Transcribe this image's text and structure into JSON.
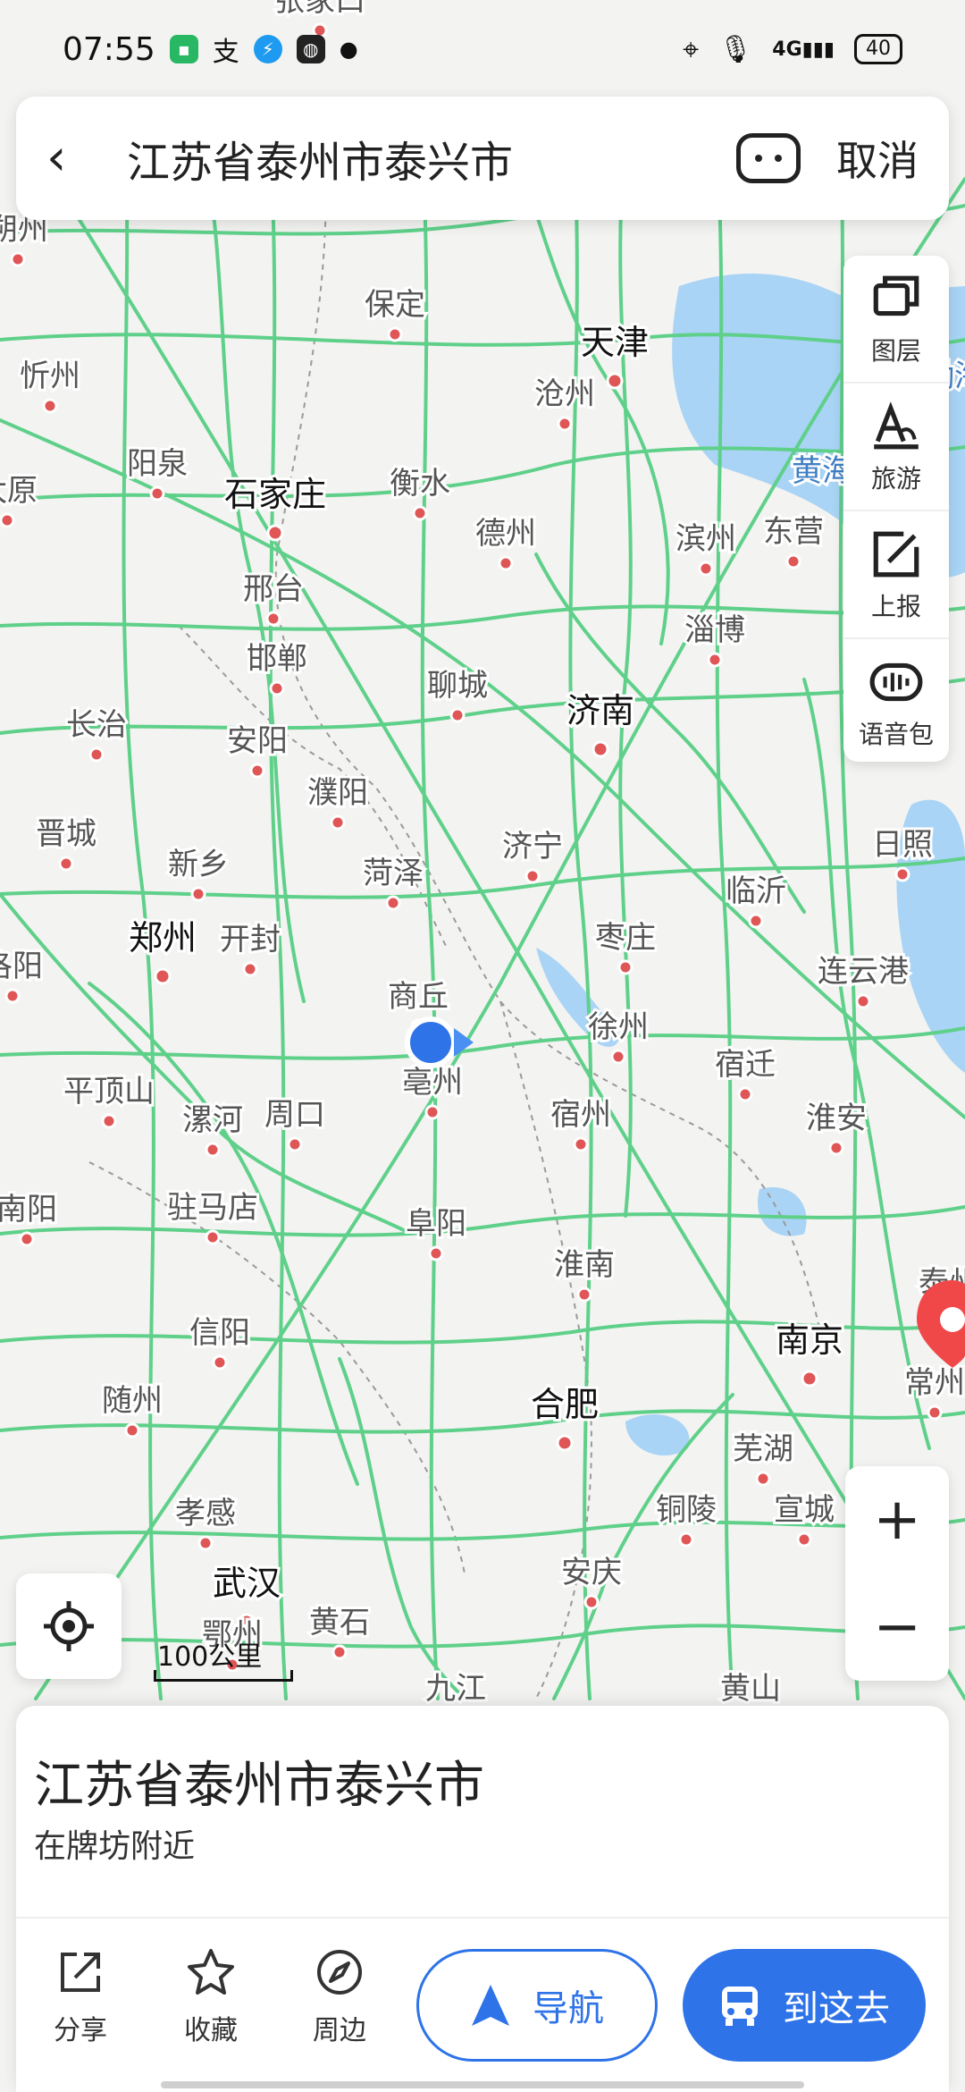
{
  "status_bar": {
    "time": "07:55",
    "network": "4G",
    "battery": "40"
  },
  "search": {
    "query": "江苏省泰州市泰兴市",
    "cancel_label": "取消"
  },
  "tools": [
    {
      "label": "图层",
      "icon": "layers-icon"
    },
    {
      "label": "旅游",
      "icon": "travel-icon"
    },
    {
      "label": "上报",
      "icon": "report-icon"
    },
    {
      "label": "语音包",
      "icon": "voice-pack-icon"
    }
  ],
  "map": {
    "scale_label": "100公里",
    "cities": [
      {
        "name": "张家口",
        "major": false
      },
      {
        "name": "朔州",
        "major": false
      },
      {
        "name": "保定",
        "major": false
      },
      {
        "name": "天津",
        "major": true
      },
      {
        "name": "忻州",
        "major": false
      },
      {
        "name": "沧州",
        "major": false
      },
      {
        "name": "阳泉",
        "major": false
      },
      {
        "name": "石家庄",
        "major": true
      },
      {
        "name": "衡水",
        "major": false
      },
      {
        "name": "太原",
        "major": false
      },
      {
        "name": "德州",
        "major": false
      },
      {
        "name": "滨州",
        "major": false
      },
      {
        "name": "东营",
        "major": false
      },
      {
        "name": "邢台",
        "major": false
      },
      {
        "name": "淄博",
        "major": false
      },
      {
        "name": "邯郸",
        "major": false
      },
      {
        "name": "聊城",
        "major": false
      },
      {
        "name": "济南",
        "major": true
      },
      {
        "name": "长治",
        "major": false
      },
      {
        "name": "安阳",
        "major": false
      },
      {
        "name": "濮阳",
        "major": false
      },
      {
        "name": "晋城",
        "major": false
      },
      {
        "name": "济宁",
        "major": false
      },
      {
        "name": "日照",
        "major": false
      },
      {
        "name": "新乡",
        "major": false
      },
      {
        "name": "菏泽",
        "major": false
      },
      {
        "name": "临沂",
        "major": false
      },
      {
        "name": "郑州",
        "major": true
      },
      {
        "name": "开封",
        "major": false
      },
      {
        "name": "枣庄",
        "major": false
      },
      {
        "name": "洛阳",
        "major": false
      },
      {
        "name": "连云港",
        "major": false
      },
      {
        "name": "商丘",
        "major": false
      },
      {
        "name": "徐州",
        "major": false
      },
      {
        "name": "平顶山",
        "major": false
      },
      {
        "name": "亳州",
        "major": false
      },
      {
        "name": "宿迁",
        "major": false
      },
      {
        "name": "漯河",
        "major": false
      },
      {
        "name": "周口",
        "major": false
      },
      {
        "name": "宿州",
        "major": false
      },
      {
        "name": "淮安",
        "major": false
      },
      {
        "name": "南阳",
        "major": false
      },
      {
        "name": "驻马店",
        "major": false
      },
      {
        "name": "阜阳",
        "major": false
      },
      {
        "name": "淮南",
        "major": false
      },
      {
        "name": "信阳",
        "major": false
      },
      {
        "name": "南京",
        "major": true
      },
      {
        "name": "随州",
        "major": false
      },
      {
        "name": "合肥",
        "major": true
      },
      {
        "name": "芜湖",
        "major": false
      },
      {
        "name": "孝感",
        "major": false
      },
      {
        "name": "铜陵",
        "major": false
      },
      {
        "name": "宣城",
        "major": false
      },
      {
        "name": "武汉",
        "major": true
      },
      {
        "name": "安庆",
        "major": false
      },
      {
        "name": "黄石",
        "major": false
      },
      {
        "name": "鄂州",
        "major": false
      },
      {
        "name": "九江",
        "major": false
      },
      {
        "name": "黄山",
        "major": false
      },
      {
        "name": "常州",
        "major": false
      },
      {
        "name": "泰州",
        "major": false
      },
      {
        "name": "黄海",
        "major": false
      },
      {
        "name": "渤海",
        "major": false
      }
    ]
  },
  "place": {
    "title": "江苏省泰州市泰兴市",
    "subtitle": "在牌坊附近"
  },
  "actions": [
    {
      "label": "分享",
      "icon": "share-icon"
    },
    {
      "label": "收藏",
      "icon": "star-icon"
    },
    {
      "label": "周边",
      "icon": "compass-icon"
    }
  ],
  "nav_label": "导航",
  "go_label": "到这去",
  "colors": {
    "road": "#5fd08a",
    "water": "#a9d4f5",
    "accent": "#2e73e8",
    "pin": "#f04848",
    "city_dot": "#e05555"
  }
}
